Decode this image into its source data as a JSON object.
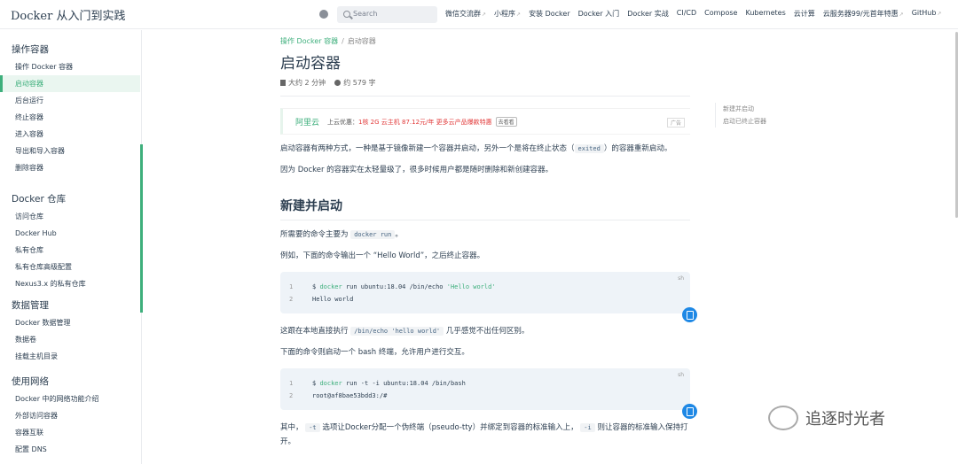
{
  "navbar": {
    "site_name": "Docker 从入门到实践",
    "search_placeholder": "Search",
    "links": [
      {
        "label": "微信交流群",
        "external": true
      },
      {
        "label": "小程序",
        "external": true
      },
      {
        "label": "安装 Docker",
        "external": false
      },
      {
        "label": "Docker 入门",
        "external": false
      },
      {
        "label": "Docker 实战",
        "external": false
      },
      {
        "label": "CI/CD",
        "external": false
      },
      {
        "label": "Compose",
        "external": false
      },
      {
        "label": "Kubernetes",
        "external": false
      },
      {
        "label": "云计算",
        "external": false
      },
      {
        "label": "云服务器99/元首年特惠",
        "external": true
      },
      {
        "label": "GitHub",
        "external": true
      }
    ]
  },
  "sidebar": {
    "groups": [
      {
        "title": "操作容器",
        "items": [
          {
            "label": "操作 Docker 容器",
            "active": false
          },
          {
            "label": "启动容器",
            "active": true
          },
          {
            "label": "后台运行",
            "active": false
          },
          {
            "label": "终止容器",
            "active": false
          },
          {
            "label": "进入容器",
            "active": false
          },
          {
            "label": "导出和导入容器",
            "active": false
          },
          {
            "label": "删除容器",
            "active": false
          }
        ]
      },
      {
        "title": "Docker 仓库",
        "items": [
          {
            "label": "访问仓库",
            "active": false
          },
          {
            "label": "Docker Hub",
            "active": false
          },
          {
            "label": "私有仓库",
            "active": false
          },
          {
            "label": "私有仓库高级配置",
            "active": false
          },
          {
            "label": "Nexus3.x 的私有仓库",
            "active": false
          }
        ]
      },
      {
        "title": "数据管理",
        "items": [
          {
            "label": "Docker 数据管理",
            "active": false
          },
          {
            "label": "数据卷",
            "active": false
          },
          {
            "label": "挂载主机目录",
            "active": false
          }
        ]
      },
      {
        "title": "使用网络",
        "items": [
          {
            "label": "Docker 中的网络功能介绍",
            "active": false
          },
          {
            "label": "外部访问容器",
            "active": false
          },
          {
            "label": "容器互联",
            "active": false
          },
          {
            "label": "配置 DNS",
            "active": false
          }
        ]
      }
    ]
  },
  "page": {
    "breadcrumb": {
      "parent": "操作 Docker 容器",
      "separator": "/",
      "current": "启动容器"
    },
    "title": "启动容器",
    "reading_time": "大约 2 分钟",
    "word_count": "约 579 字",
    "ad": {
      "brand": "阿里云",
      "prefix": "上云优惠：",
      "highlight": "1核 2G 云主机 87.12元/年 更多云产品爆款特惠",
      "button": "去看看",
      "tag": "广告"
    },
    "intro_1a": "启动容器有两种方式，一种是基于镜像新建一个容器并启动，另外一个是将在终止状态（",
    "intro_1_code": "exited",
    "intro_1b": "）的容器重新启动。",
    "intro_2": "因为 Docker 的容器实在太轻量级了，很多时候用户都是随时删除和新创建容器。",
    "section_title": "新建并启动",
    "s1_a": "所需要的命令主要为",
    "s1_code": "docker run",
    "s1_b": "。",
    "s2": "例如，下面的命令输出一个 “Hello World”，之后终止容器。",
    "code1": {
      "lang": "sh",
      "l1_prompt": "$ ",
      "l1_cmd": "docker",
      "l1_rest": " run ubuntu:18.04 /bin/echo ",
      "l1_str": "'Hello world'",
      "l2": "Hello world"
    },
    "s3_a": "这跟在本地直接执行",
    "s3_code": "/bin/echo 'hello world'",
    "s3_b": "几乎感觉不出任何区别。",
    "s4": "下面的命令则启动一个 bash 终端，允许用户进行交互。",
    "code2": {
      "lang": "sh",
      "l1_prompt": "$ ",
      "l1_cmd": "docker",
      "l1_rest": " run -t -i ubuntu:18.04 /bin/bash",
      "l2": "root@af8bae53bdd3:/#"
    },
    "s5_a": "其中，",
    "s5_code1": "-t",
    "s5_b": "选项让Docker分配一个伪终端（pseudo-tty）并绑定到容器的标准输入上，",
    "s5_code2": "-i",
    "s5_c": "则让容器的标准输入保持打开。"
  },
  "toc": [
    "新建并启动",
    "启动已终止容器"
  ],
  "watermark": "追逐时光者",
  "colors": {
    "accent": "#3eaf7c",
    "copy_button": "#1e88e5",
    "ad_red": "#e23b3b"
  }
}
